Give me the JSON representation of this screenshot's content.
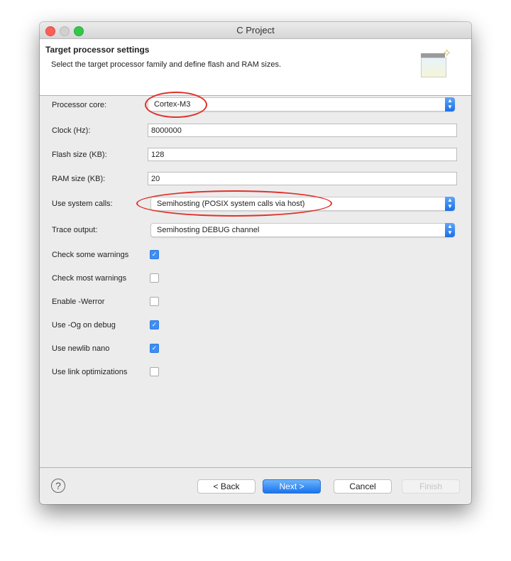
{
  "window": {
    "title": "C Project"
  },
  "header": {
    "title": "Target processor settings",
    "subtitle": "Select the target processor family and define flash and RAM sizes."
  },
  "form": {
    "processor_core": {
      "label": "Processor core:",
      "value": "Cortex-M3"
    },
    "clock": {
      "label": "Clock (Hz):",
      "value": "8000000"
    },
    "flash": {
      "label": "Flash size (KB):",
      "value": "128"
    },
    "ram": {
      "label": "RAM size (KB):",
      "value": "20"
    },
    "system_calls": {
      "label": "Use system calls:",
      "value": "Semihosting (POSIX system calls via host)"
    },
    "trace": {
      "label": "Trace output:",
      "value": "Semihosting DEBUG channel"
    },
    "checkboxes": [
      {
        "label": "Check some warnings",
        "checked": true
      },
      {
        "label": "Check most warnings",
        "checked": false
      },
      {
        "label": "Enable -Werror",
        "checked": false
      },
      {
        "label": "Use -Og on debug",
        "checked": true
      },
      {
        "label": "Use newlib nano",
        "checked": true
      },
      {
        "label": "Use link optimizations",
        "checked": false
      }
    ]
  },
  "footer": {
    "help": "?",
    "back": "< Back",
    "next": "Next >",
    "cancel": "Cancel",
    "finish": "Finish"
  },
  "colors": {
    "accent": "#1b6fe8",
    "annotation": "#e0302a"
  }
}
